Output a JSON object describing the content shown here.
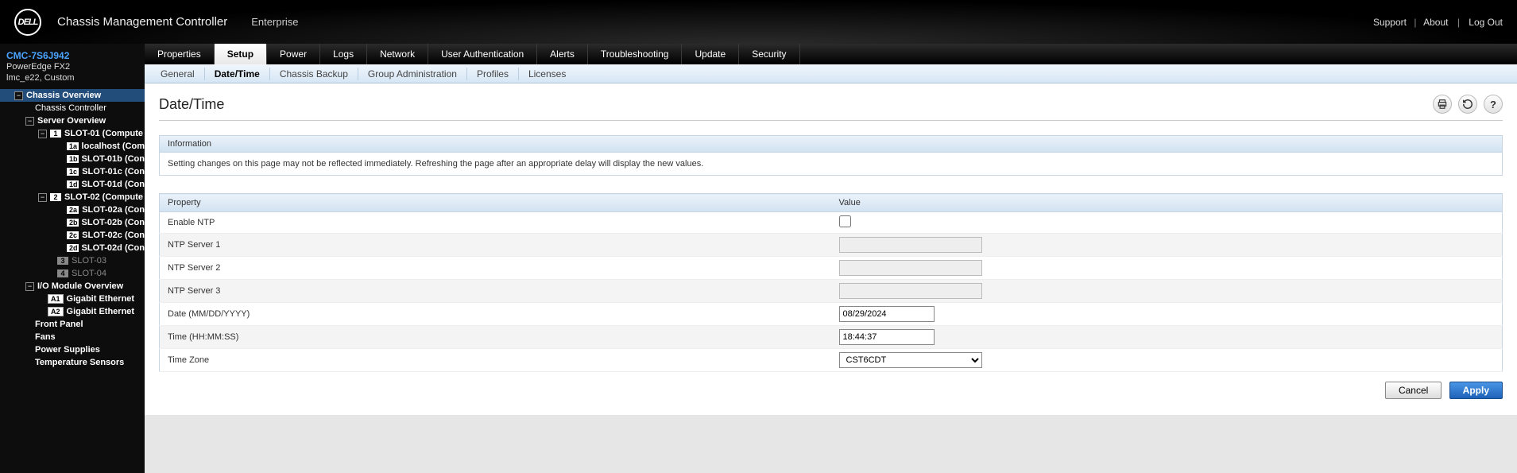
{
  "header": {
    "logo_text": "DELL",
    "title": "Chassis Management Controller",
    "subtitle": "Enterprise",
    "links": {
      "support": "Support",
      "about": "About",
      "logout": "Log Out"
    }
  },
  "device": {
    "id": "CMC-7S6J942",
    "model": "PowerEdge FX2",
    "location": "lmc_e22, Custom"
  },
  "tree": {
    "root": "Chassis Overview",
    "controller": "Chassis Controller",
    "server_overview": "Server Overview",
    "slot1": {
      "badge": "1",
      "label": "SLOT-01 (Compute"
    },
    "slot1a": {
      "badge": "1a",
      "label": "localhost (Com"
    },
    "slot1b": {
      "badge": "1b",
      "label": "SLOT-01b (Con"
    },
    "slot1c": {
      "badge": "1c",
      "label": "SLOT-01c (Con"
    },
    "slot1d": {
      "badge": "1d",
      "label": "SLOT-01d (Con"
    },
    "slot2": {
      "badge": "2",
      "label": "SLOT-02 (Compute"
    },
    "slot2a": {
      "badge": "2a",
      "label": "SLOT-02a (Con"
    },
    "slot2b": {
      "badge": "2b",
      "label": "SLOT-02b (Con"
    },
    "slot2c": {
      "badge": "2c",
      "label": "SLOT-02c (Con"
    },
    "slot2d": {
      "badge": "2d",
      "label": "SLOT-02d (Con"
    },
    "slot3": {
      "badge": "3",
      "label": "SLOT-03"
    },
    "slot4": {
      "badge": "4",
      "label": "SLOT-04"
    },
    "io_overview": "I/O Module Overview",
    "ioa1": {
      "badge": "A1",
      "label": "Gigabit Ethernet"
    },
    "ioa2": {
      "badge": "A2",
      "label": "Gigabit Ethernet"
    },
    "front": "Front Panel",
    "fans": "Fans",
    "psu": "Power Supplies",
    "temp": "Temperature Sensors"
  },
  "tabs1": {
    "properties": "Properties",
    "setup": "Setup",
    "power": "Power",
    "logs": "Logs",
    "network": "Network",
    "userauth": "User Authentication",
    "alerts": "Alerts",
    "trouble": "Troubleshooting",
    "update": "Update",
    "security": "Security"
  },
  "tabs2": {
    "general": "General",
    "datetime": "Date/Time",
    "backup": "Chassis Backup",
    "group": "Group Administration",
    "profiles": "Profiles",
    "licenses": "Licenses"
  },
  "page": {
    "title": "Date/Time",
    "info_hdr": "Information",
    "info_body": "Setting changes on this page may not be reflected immediately. Refreshing the page after an appropriate delay will display the new values.",
    "col_property": "Property",
    "col_value": "Value",
    "rows": {
      "enable_ntp": "Enable NTP",
      "ntp1": "NTP Server 1",
      "ntp2": "NTP Server 2",
      "ntp3": "NTP Server 3",
      "date": "Date (MM/DD/YYYY)",
      "time": "Time (HH:MM:SS)",
      "tz": "Time Zone"
    },
    "values": {
      "enable_ntp": false,
      "ntp1": "",
      "ntp2": "",
      "ntp3": "",
      "date": "08/29/2024",
      "time": "18:44:37",
      "tz": "CST6CDT"
    },
    "buttons": {
      "cancel": "Cancel",
      "apply": "Apply"
    }
  }
}
